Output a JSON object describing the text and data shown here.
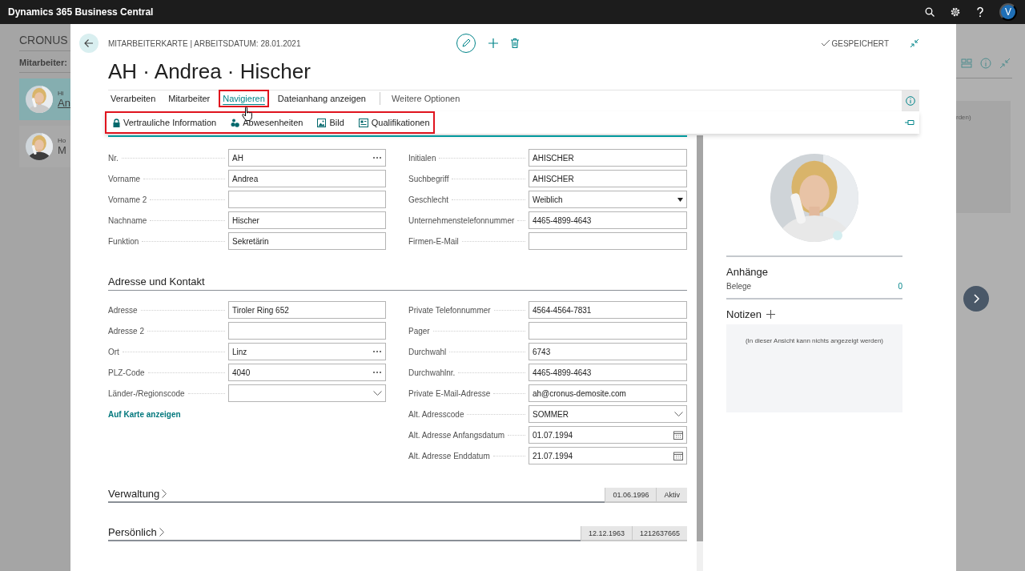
{
  "app_bar": {
    "title": "Dynamics 365 Business Central",
    "avatar": "V"
  },
  "background_page": {
    "title": "CRONUS",
    "list_label": "Mitarbeiter:",
    "notes_fragment": "rden)",
    "cards": [
      {
        "line_1": "Hi",
        "line_2": "An",
        "selected": true
      },
      {
        "line_1": "Ho",
        "line_2": "M",
        "selected": false
      }
    ]
  },
  "card": {
    "caption": "MITARBEITERKARTE | ARBEITSDATUM: 28.01.2021",
    "title": "AH · Andrea · Hischer",
    "save_status": "GESPEICHERT",
    "actions": [
      {
        "label": "Verarbeiten",
        "selected": false,
        "highlighted": false
      },
      {
        "label": "Mitarbeiter",
        "selected": false,
        "highlighted": false
      },
      {
        "label": "Navigieren",
        "selected": true,
        "highlighted": true
      },
      {
        "label": "Dateianhang anzeigen",
        "selected": false,
        "highlighted": false
      }
    ],
    "more_label": "Weitere Optionen",
    "submenu": {
      "highlighted": true,
      "items": [
        {
          "label": "Vertrauliche Information"
        },
        {
          "label": "Abwesenheiten"
        },
        {
          "label": "Bild"
        },
        {
          "label": "Qualifikationen"
        }
      ]
    },
    "general": {
      "left": [
        {
          "label": "Nr.",
          "value": "AH",
          "kind": "lookup"
        },
        {
          "label": "Vorname",
          "value": "Andrea",
          "kind": "text"
        },
        {
          "label": "Vorname 2",
          "kind": "text"
        },
        {
          "label": "Nachname",
          "value": "Hischer",
          "kind": "text"
        },
        {
          "label": "Funktion",
          "value": "Sekretärin",
          "kind": "text"
        }
      ],
      "right": [
        {
          "label": "Initialen",
          "value": "AHISCHER",
          "kind": "text"
        },
        {
          "label": "Suchbegriff",
          "value": "AHISCHER",
          "kind": "text"
        },
        {
          "label": "Geschlecht",
          "value": "Weiblich",
          "kind": "dropdown"
        },
        {
          "label": "Unternehmenstelefonnummer",
          "value": "4465-4899-4643",
          "kind": "text"
        },
        {
          "label": "Firmen-E-Mail",
          "kind": "text"
        }
      ]
    },
    "address": {
      "title": "Adresse und Kontakt",
      "link": "Auf Karte anzeigen",
      "left": [
        {
          "label": "Adresse",
          "value": "Tiroler Ring 652",
          "kind": "text"
        },
        {
          "label": "Adresse 2",
          "kind": "text"
        },
        {
          "label": "Ort",
          "value": "Linz",
          "kind": "lookup"
        },
        {
          "label": "PLZ-Code",
          "value": "4040",
          "kind": "lookup"
        },
        {
          "label": "Länder-/Regionscode",
          "kind": "select"
        }
      ],
      "right": [
        {
          "label": "Private Telefonnummer",
          "value": "4564-4564-7831",
          "kind": "text"
        },
        {
          "label": "Pager",
          "kind": "text"
        },
        {
          "label": "Durchwahl",
          "value": "6743",
          "kind": "text"
        },
        {
          "label": "Durchwahlnr.",
          "value": "4465-4899-4643",
          "kind": "text"
        },
        {
          "label": "Private E-Mail-Adresse",
          "value": "ah@cronus-demosite.com",
          "kind": "text"
        },
        {
          "label": "Alt. Adresscode",
          "value": "SOMMER",
          "kind": "select"
        },
        {
          "label": "Alt. Adresse Anfangsdatum",
          "value": "01.07.1994",
          "kind": "date"
        },
        {
          "label": "Alt. Adresse Enddatum",
          "value": "21.07.1994",
          "kind": "date"
        }
      ]
    },
    "collapsed_sections": [
      {
        "title": "Verwaltung",
        "tags": [
          "01.06.1996",
          "Aktiv"
        ]
      },
      {
        "title": "Persönlich",
        "tags": [
          "12.12.1963",
          "1212637665"
        ]
      }
    ],
    "factbox": {
      "attachments_title": "Anhänge",
      "attachments": [
        {
          "label": "Belege",
          "count": "0"
        }
      ],
      "notes_title": "Notizen",
      "notes_empty": "(In dieser Ansicht kann nichts angezeigt werden)"
    }
  }
}
